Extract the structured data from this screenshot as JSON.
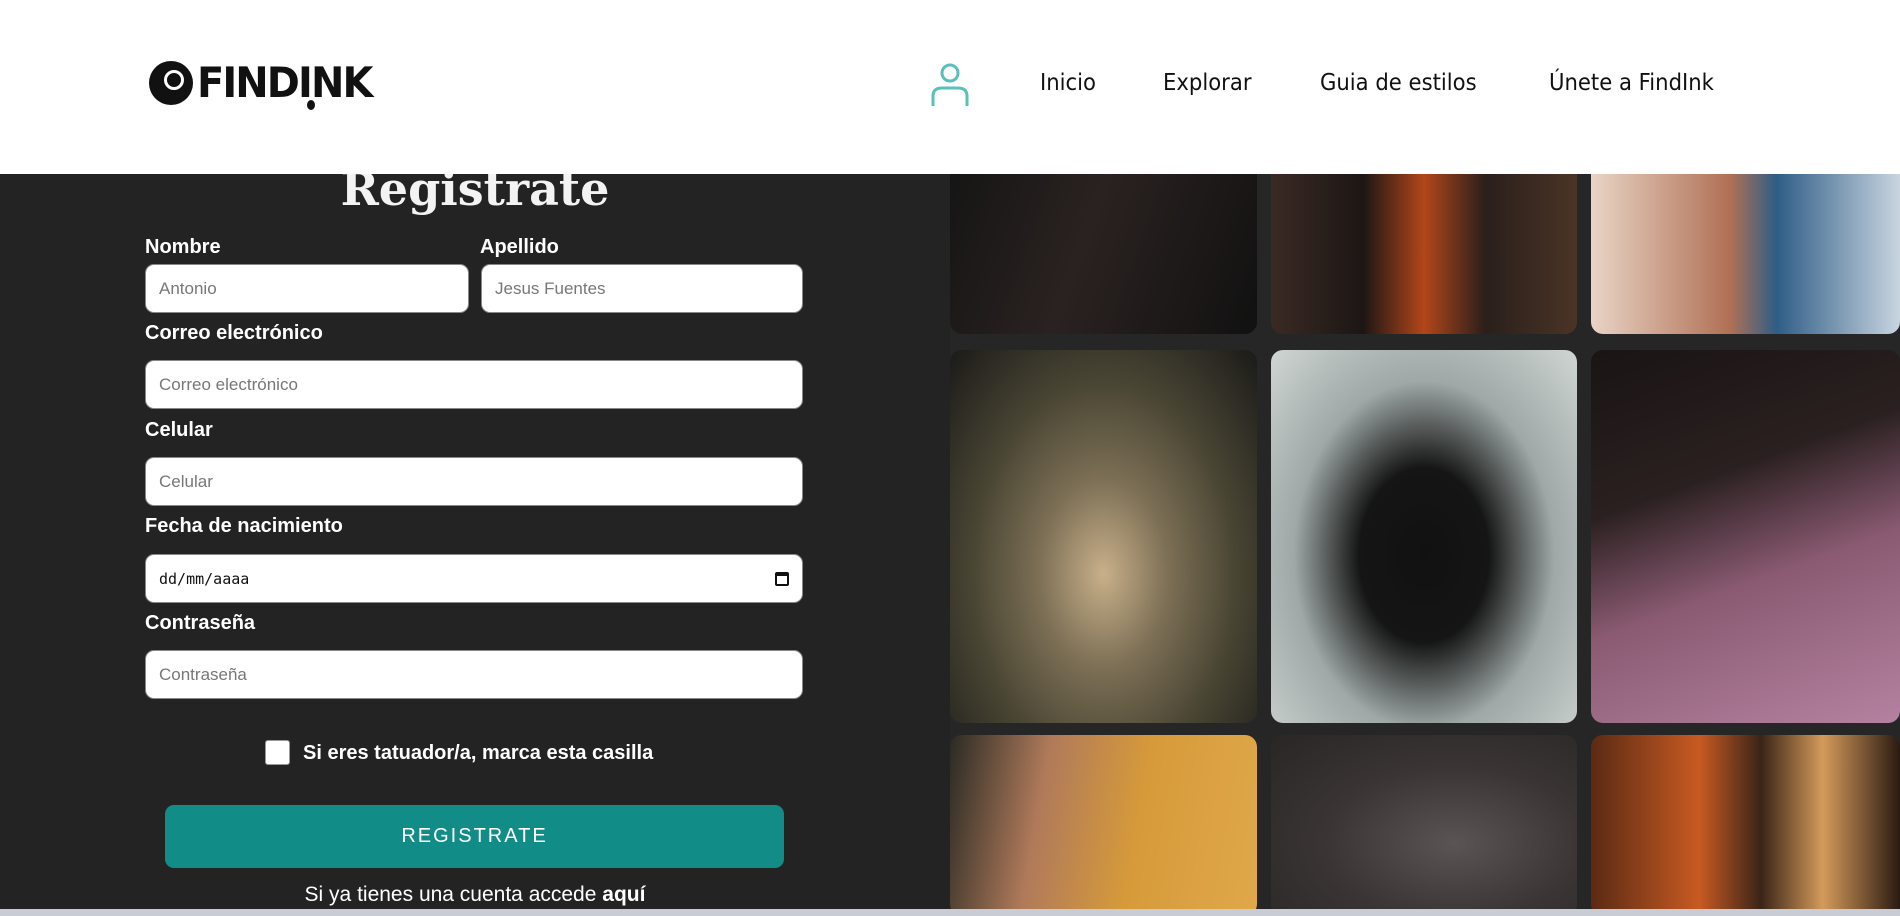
{
  "header": {
    "logo": "FINDINK",
    "nav": [
      "Inicio",
      "Explorar",
      "Guia de estilos",
      "Únete a FindInk"
    ],
    "accent": "#5bbfba"
  },
  "form": {
    "title": "Registrate",
    "nombre": {
      "label": "Nombre",
      "placeholder": "Antonio"
    },
    "apellido": {
      "label": "Apellido",
      "placeholder": "Jesus Fuentes"
    },
    "correo": {
      "label": "Correo electrónico",
      "placeholder": "Correo electrónico"
    },
    "celular": {
      "label": "Celular",
      "placeholder": "Celular"
    },
    "fecha": {
      "label": "Fecha de nacimiento",
      "placeholder": "dd/mm/aaaa"
    },
    "password": {
      "label": "Contraseña",
      "placeholder": "Contraseña"
    },
    "checkbox_label": "Si eres tatuador/a, marca esta casilla",
    "submit": "REGISTRATE",
    "login_text": "Si ya tienes una cuenta accede",
    "login_link": "aquí",
    "button_color": "#118c86"
  },
  "gallery": {
    "images": [
      "tattoo-photo-1",
      "tattoo-photo-2",
      "tattoo-photo-3",
      "tattoo-back-photo",
      "tattoo-artist-photo",
      "tattooing-photo",
      "tattoo-thigh-photo",
      "tattoo-machine-photo",
      "tattoo-arm-photo"
    ]
  }
}
